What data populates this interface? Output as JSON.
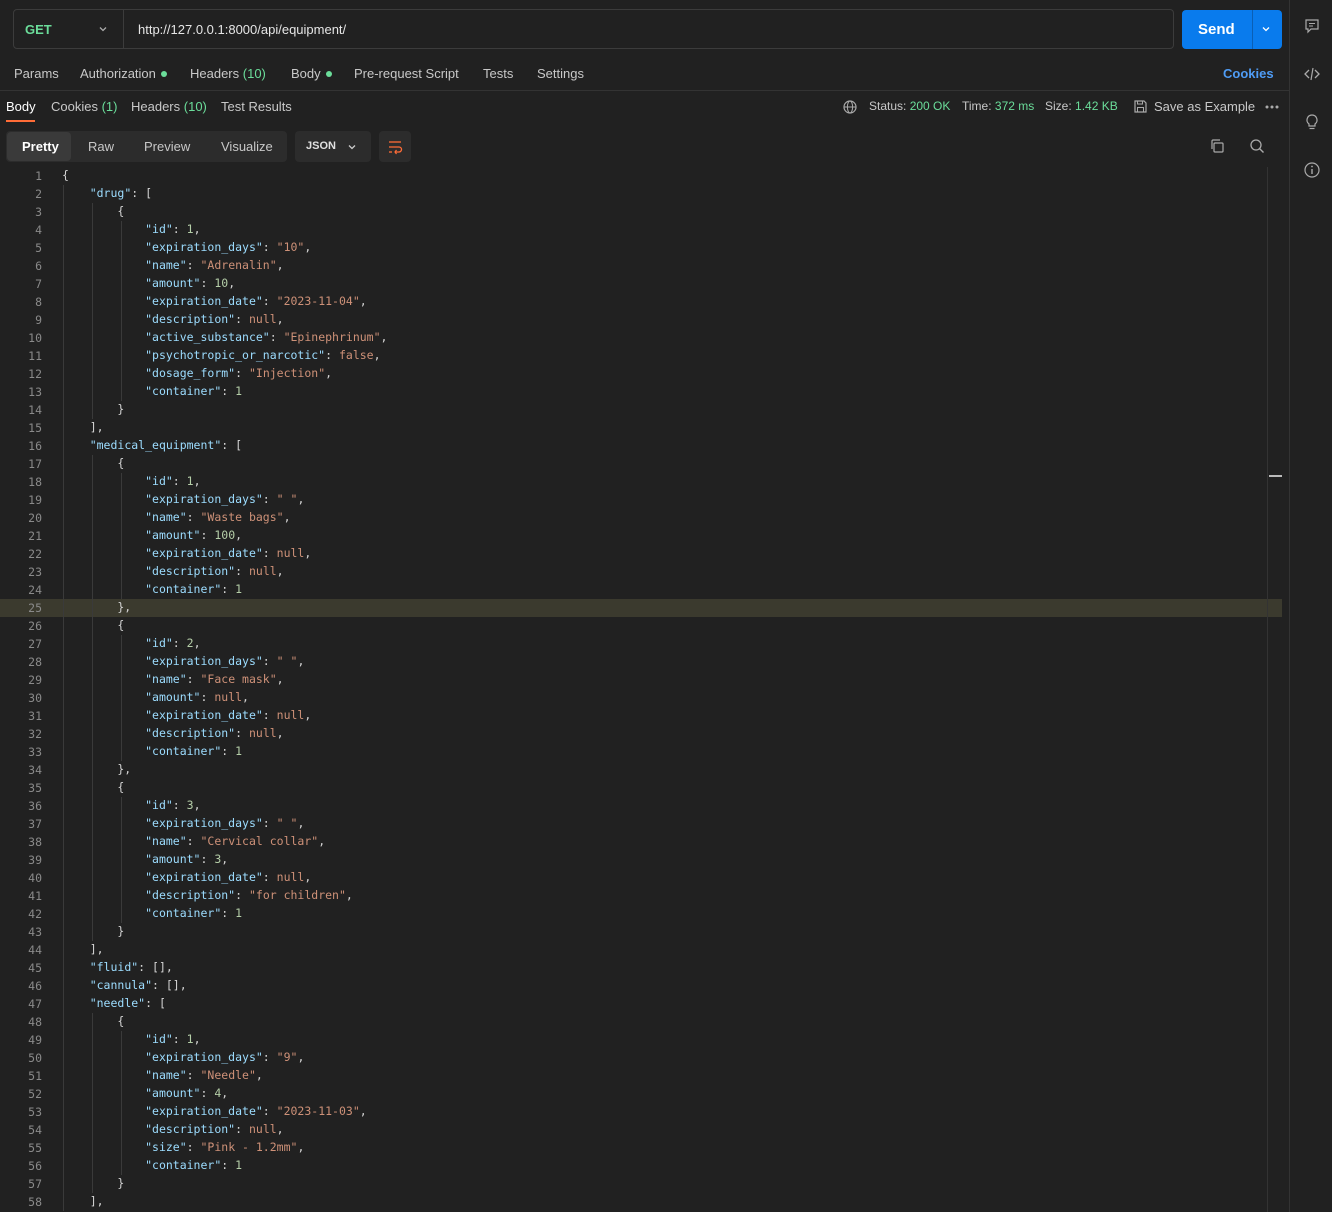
{
  "request": {
    "method": "GET",
    "url": "http://127.0.0.1:8000/api/equipment/",
    "send_label": "Send"
  },
  "request_tabs": {
    "params": "Params",
    "authorization": "Authorization",
    "headers": "Headers",
    "headers_count": "(10)",
    "body": "Body",
    "prerequest": "Pre-request Script",
    "tests": "Tests",
    "settings": "Settings",
    "cookies": "Cookies"
  },
  "response_tabs": {
    "body": "Body",
    "cookies": "Cookies",
    "cookies_count": "(1)",
    "headers": "Headers",
    "headers_count": "(10)",
    "test_results": "Test Results"
  },
  "response_status": {
    "status_label": "Status:",
    "status_value": "200 OK",
    "time_label": "Time:",
    "time_value": "372 ms",
    "size_label": "Size:",
    "size_value": "1.42 KB",
    "save_example": "Save as Example"
  },
  "view": {
    "modes": [
      "Pretty",
      "Raw",
      "Preview",
      "Visualize"
    ],
    "format": "JSON"
  },
  "highlighted_line": 25,
  "code_lines": [
    "{",
    "    \"drug\": [",
    "        {",
    "            \"id\": 1,",
    "            \"expiration_days\": \"10\",",
    "            \"name\": \"Adrenalin\",",
    "            \"amount\": 10,",
    "            \"expiration_date\": \"2023-11-04\",",
    "            \"description\": null,",
    "            \"active_substance\": \"Epinephrinum\",",
    "            \"psychotropic_or_narcotic\": false,",
    "            \"dosage_form\": \"Injection\",",
    "            \"container\": 1",
    "        }",
    "    ],",
    "    \"medical_equipment\": [",
    "        {",
    "            \"id\": 1,",
    "            \"expiration_days\": \" \",",
    "            \"name\": \"Waste bags\",",
    "            \"amount\": 100,",
    "            \"expiration_date\": null,",
    "            \"description\": null,",
    "            \"container\": 1",
    "        },",
    "        {",
    "            \"id\": 2,",
    "            \"expiration_days\": \" \",",
    "            \"name\": \"Face mask\",",
    "            \"amount\": null,",
    "            \"expiration_date\": null,",
    "            \"description\": null,",
    "            \"container\": 1",
    "        },",
    "        {",
    "            \"id\": 3,",
    "            \"expiration_days\": \" \",",
    "            \"name\": \"Cervical collar\",",
    "            \"amount\": 3,",
    "            \"expiration_date\": null,",
    "            \"description\": \"for children\",",
    "            \"container\": 1",
    "        }",
    "    ],",
    "    \"fluid\": [],",
    "    \"cannula\": [],",
    "    \"needle\": [",
    "        {",
    "            \"id\": 1,",
    "            \"expiration_days\": \"9\",",
    "            \"name\": \"Needle\",",
    "            \"amount\": 4,",
    "            \"expiration_date\": \"2023-11-03\",",
    "            \"description\": null,",
    "            \"size\": \"Pink - 1.2mm\",",
    "            \"container\": 1",
    "        }",
    "    ],"
  ],
  "colors": {
    "accent": "#097bed",
    "method": "#6bdd9a",
    "status_ok": "#6bdd9a",
    "tab_underline": "#ff6c37",
    "json_key": "#9cdcfe",
    "json_string": "#ce9178",
    "json_number": "#b5cea8"
  },
  "sidebar_icons": [
    "comments-icon",
    "code-icon",
    "lightbulb-icon",
    "info-icon"
  ]
}
